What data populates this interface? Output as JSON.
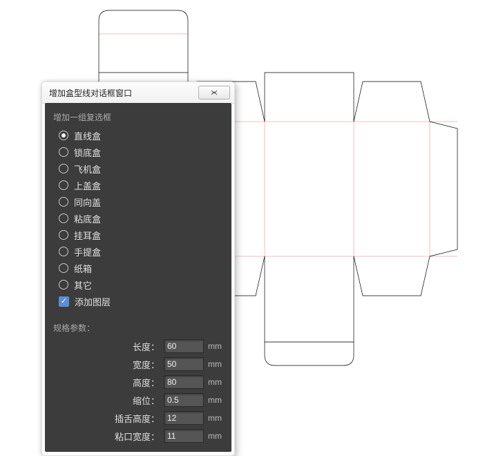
{
  "dialog": {
    "title": "增加盒型线对话框窗口",
    "close": "✕",
    "group_label": "增加一组复选框",
    "options": [
      {
        "label": "直线盒",
        "selected": true
      },
      {
        "label": "锁底盒",
        "selected": false
      },
      {
        "label": "飞机盒",
        "selected": false
      },
      {
        "label": "上盖盒",
        "selected": false
      },
      {
        "label": "同向盖",
        "selected": false
      },
      {
        "label": "粘底盒",
        "selected": false
      },
      {
        "label": "挂耳盒",
        "selected": false
      },
      {
        "label": "手提盒",
        "selected": false
      },
      {
        "label": "纸箱",
        "selected": false
      },
      {
        "label": "其它",
        "selected": false
      }
    ],
    "add_layer": {
      "label": "添加图层",
      "checked": true
    },
    "params_label": "规格参数：",
    "params": [
      {
        "label": "长度：",
        "value": "60",
        "unit": "mm"
      },
      {
        "label": "宽度：",
        "value": "50",
        "unit": "mm"
      },
      {
        "label": "高度：",
        "value": "80",
        "unit": "mm"
      },
      {
        "label": "缩位：",
        "value": "0.5",
        "unit": "mm"
      },
      {
        "label": "插舌高度：",
        "value": "12",
        "unit": "mm"
      },
      {
        "label": "粘口宽度：",
        "value": "11",
        "unit": "mm"
      }
    ]
  }
}
